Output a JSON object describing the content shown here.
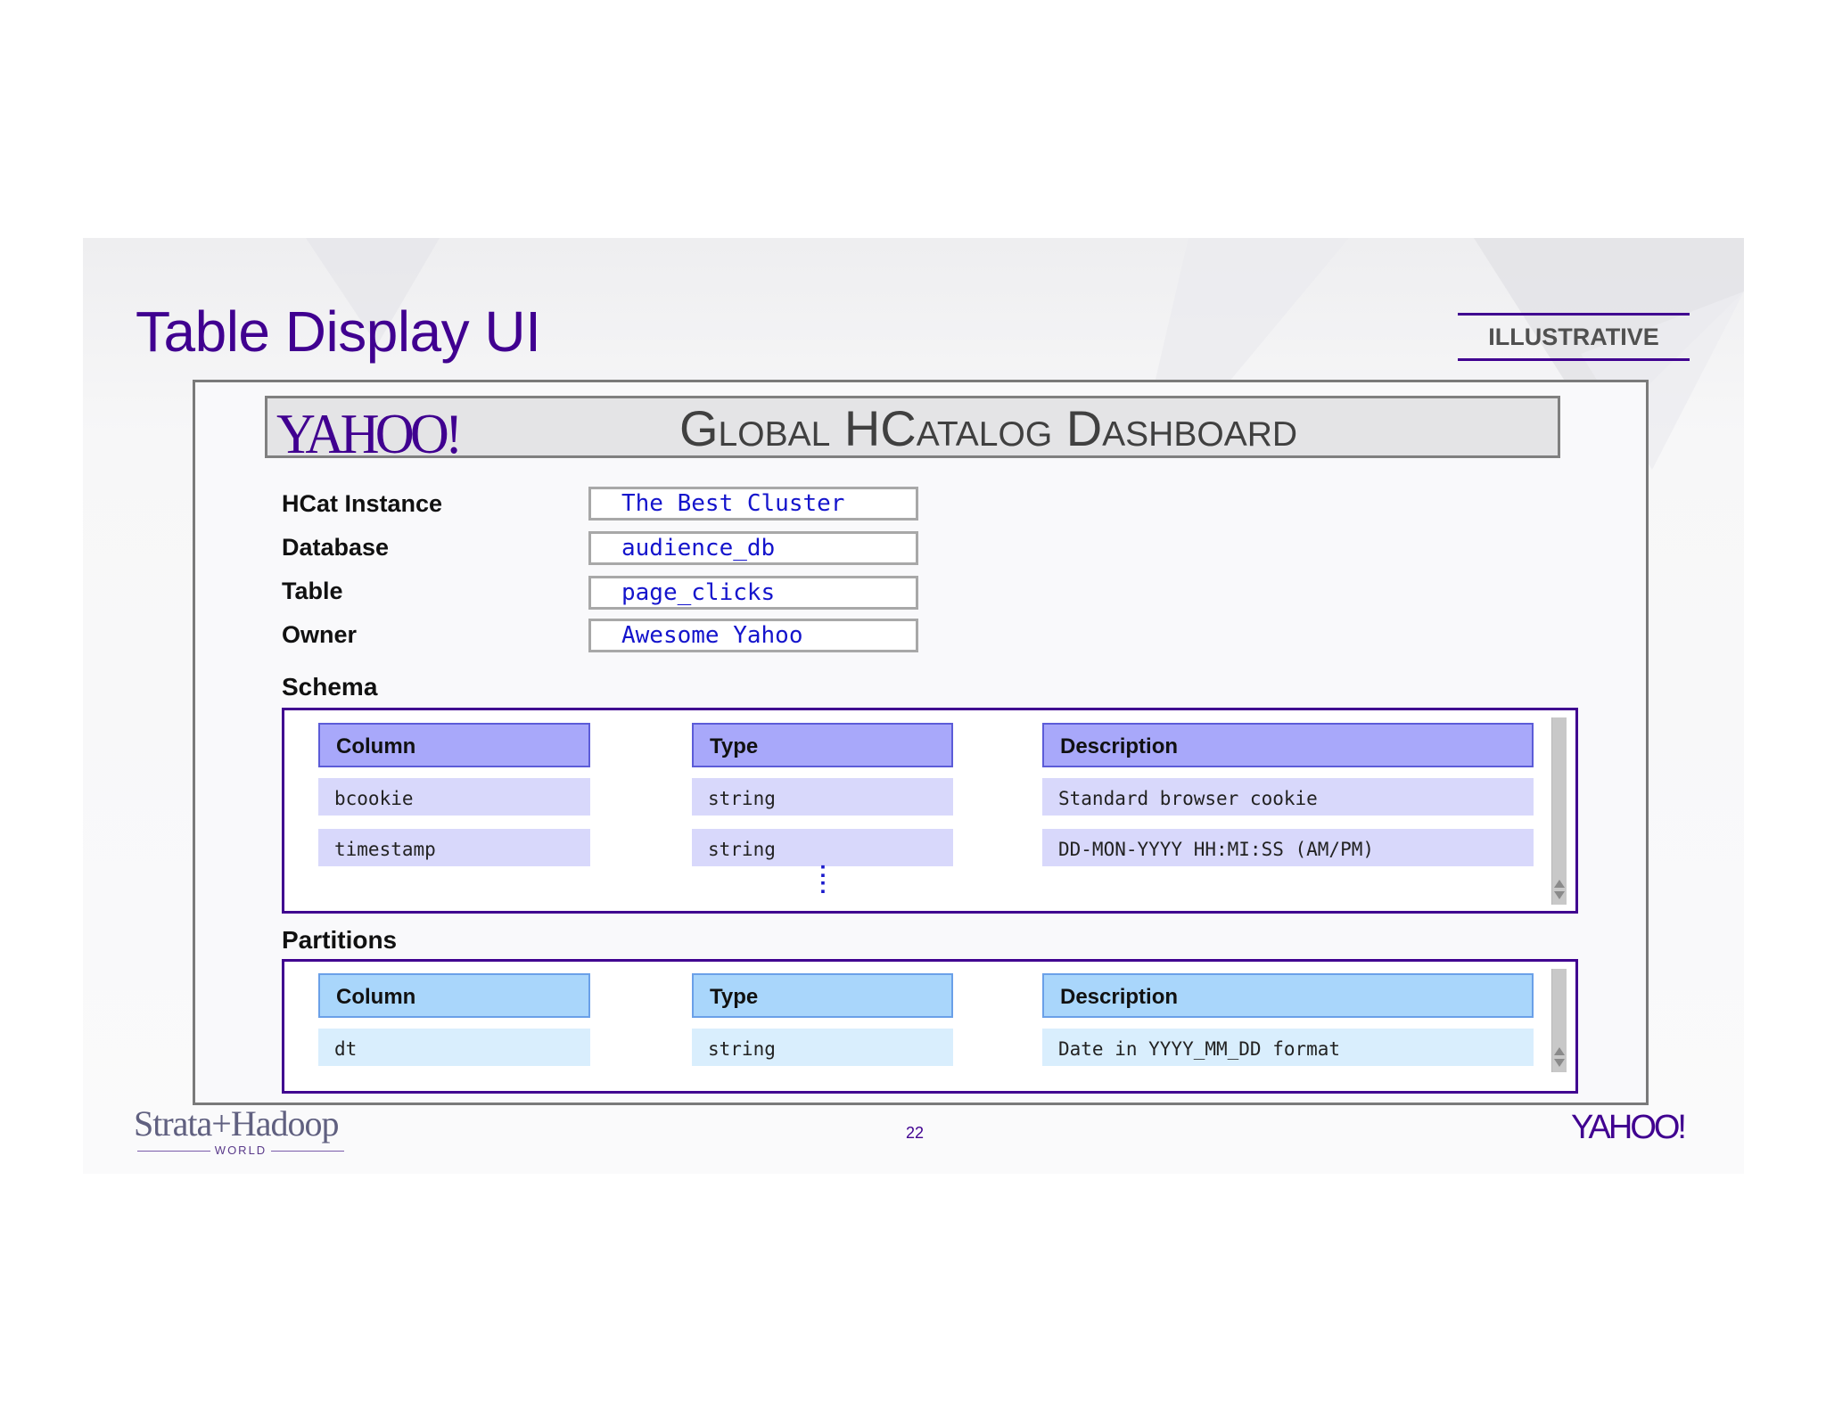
{
  "slide": {
    "title": "Table Display UI",
    "tag": "ILLUSTRATIVE",
    "page_number": "22"
  },
  "header": {
    "logo": "YAHOO!",
    "title": "Global HCatalog Dashboard"
  },
  "fields": [
    {
      "label": "HCat Instance",
      "value": "The Best Cluster"
    },
    {
      "label": "Database",
      "value": "audience_db"
    },
    {
      "label": "Table",
      "value": "page_clicks"
    },
    {
      "label": "Owner",
      "value": "Awesome Yahoo"
    }
  ],
  "schema": {
    "label": "Schema",
    "headers": [
      "Column",
      "Type",
      "Description"
    ],
    "rows": [
      [
        "bcookie",
        "string",
        "Standard browser cookie"
      ],
      [
        "timestamp",
        "string",
        "DD-MON-YYYY HH:MI:SS (AM/PM)"
      ]
    ],
    "more_indicator": ":"
  },
  "partitions": {
    "label": "Partitions",
    "headers": [
      "Column",
      "Type",
      "Description"
    ],
    "rows": [
      [
        "dt",
        "string",
        "Date in YYYY_MM_DD format"
      ]
    ]
  },
  "footer": {
    "left_logo": "Strata+Hadoop",
    "left_logo_sub": "WORLD",
    "right_logo": "YAHOO!"
  },
  "colors": {
    "brand_purple": "#400090",
    "field_text": "#1414cc",
    "schema_header": "#a8a8fa",
    "schema_cell": "#d8d8fb",
    "partition_header": "#a9d6fb",
    "partition_cell": "#d9eefd"
  },
  "icons": [
    "scroll-up-arrow-icon",
    "scroll-down-arrow-icon"
  ]
}
